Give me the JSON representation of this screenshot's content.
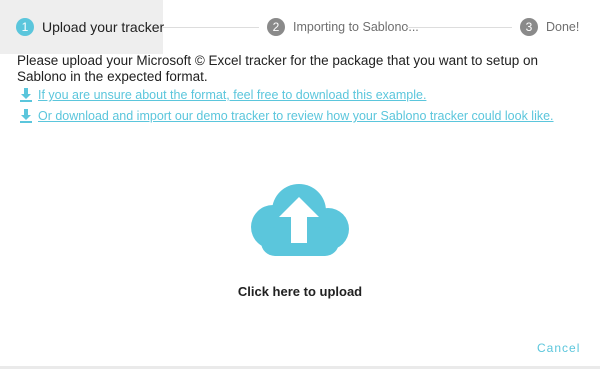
{
  "stepper": {
    "steps": [
      {
        "number": "1",
        "label": "Upload your tracker"
      },
      {
        "number": "2",
        "label": "Importing to Sablono..."
      },
      {
        "number": "3",
        "label": "Done!"
      }
    ]
  },
  "intro": {
    "text": "Please upload your Microsoft © Excel tracker for the package that you want to setup on Sablono in the expected format."
  },
  "links": [
    {
      "icon": "download-icon",
      "label": "If you are unsure about the format, feel free to download this example."
    },
    {
      "icon": "download-icon",
      "label": "Or download and import our demo tracker to review how your Sablono tracker could look like."
    }
  ],
  "upload": {
    "icon": "cloud-upload-icon",
    "label": "Click here to upload"
  },
  "actions": {
    "cancel_label": "Cancel"
  },
  "colors": {
    "accent": "#5bc6dc",
    "inactive_step": "#8a8a8a",
    "active_step_bg": "#eeeeee"
  }
}
